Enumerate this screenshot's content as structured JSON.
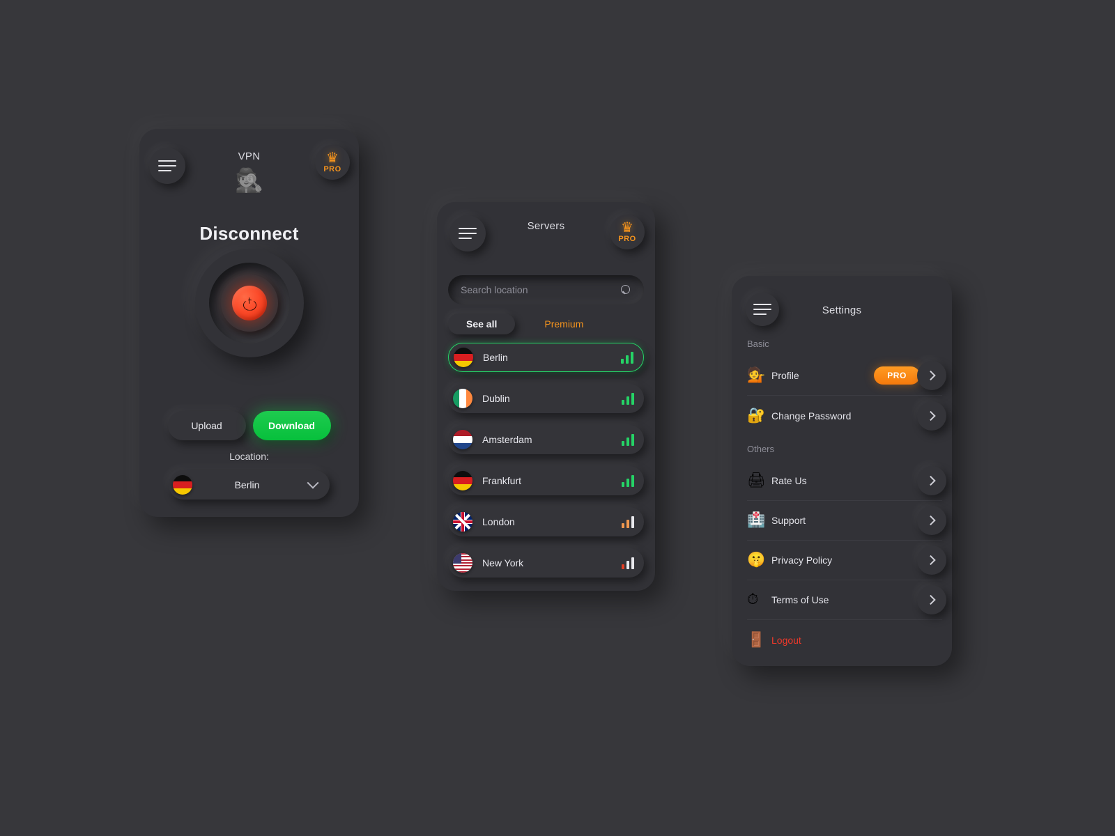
{
  "theme": {
    "page_bg": "#37373b",
    "card_bg": "#323237",
    "accent_orange": "#f5941d",
    "accent_green": "#07c03c",
    "danger_red": "#f0392a"
  },
  "vpn_card": {
    "menu_icon": "hamburger-menu-icon",
    "title": "VPN",
    "logo_icon": "🕵",
    "pro_badge": {
      "crown_icon": "👑",
      "label": "PRO"
    },
    "connection_state": "Disconnect",
    "power_button": {
      "icon": "power-icon",
      "state_color": "#fb4a29"
    },
    "upload_label": "Upload",
    "download_label": "Download",
    "location_label": "Location:",
    "selected_location": {
      "name": "Berlin",
      "flag": "de"
    },
    "dropdown_icon": "chevron-down-icon"
  },
  "servers_card": {
    "menu_icon": "hamburger-menu-icon",
    "title": "Servers",
    "pro_badge": {
      "crown_icon": "👑",
      "label": "PRO"
    },
    "search": {
      "value": "",
      "placeholder": "Search location",
      "icon": "search-icon"
    },
    "tabs": [
      {
        "label": "See all",
        "active": true
      },
      {
        "label": "Premium",
        "active": false
      }
    ],
    "items": [
      {
        "name": "Berlin",
        "flag": "de",
        "selected": true,
        "signal": "strong",
        "signal_color": "#25d366"
      },
      {
        "name": "Dublin",
        "flag": "ie",
        "selected": false,
        "signal": "strong",
        "signal_color": "#25d366"
      },
      {
        "name": "Amsterdam",
        "flag": "nl",
        "selected": false,
        "signal": "strong",
        "signal_color": "#25d366"
      },
      {
        "name": "Frankfurt",
        "flag": "de",
        "selected": false,
        "signal": "strong",
        "signal_color": "#25d366"
      },
      {
        "name": "London",
        "flag": "gb",
        "selected": false,
        "signal": "medium",
        "signal_color": "#f0984f"
      },
      {
        "name": "New York",
        "flag": "us",
        "selected": false,
        "signal": "weak",
        "signal_color": "#e43d23"
      }
    ]
  },
  "settings_card": {
    "menu_icon": "hamburger-menu-icon",
    "title": "Settings",
    "groups": [
      {
        "label": "Basic",
        "items": [
          {
            "icon": "💁",
            "label": "Profile",
            "badge": "PRO",
            "chevron": "chevron-right-icon"
          },
          {
            "icon": "🔐",
            "label": "Change Password",
            "badge": null,
            "chevron": "chevron-right-icon"
          }
        ]
      },
      {
        "label": "Others",
        "items": [
          {
            "icon": "🖨",
            "label": "Rate Us",
            "badge": null,
            "chevron": "chevron-right-icon"
          },
          {
            "icon": "🏥",
            "label": "Support",
            "badge": null,
            "chevron": "chevron-right-icon"
          },
          {
            "icon": "🤫",
            "label": "Privacy Policy",
            "badge": null,
            "chevron": "chevron-right-icon"
          },
          {
            "icon": "⏱",
            "label": "Terms of Use",
            "badge": null,
            "chevron": "chevron-right-icon"
          },
          {
            "icon": "🚪",
            "label": "Logout",
            "badge": null,
            "chevron": null,
            "danger": true
          }
        ]
      }
    ]
  }
}
